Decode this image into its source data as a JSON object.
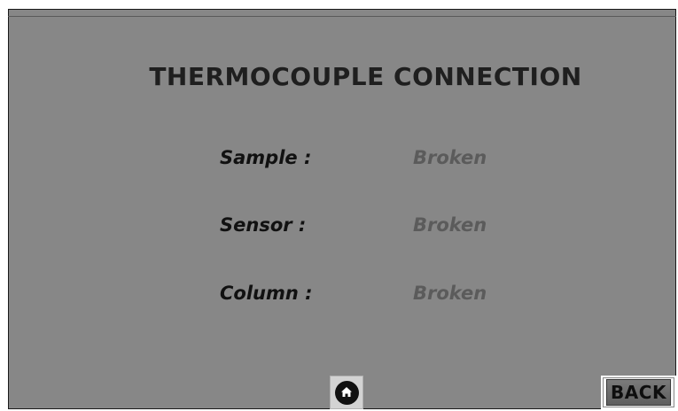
{
  "screen": {
    "title": "THERMOCOUPLE CONNECTION"
  },
  "rows": [
    {
      "label": "Sample :",
      "value": "Broken"
    },
    {
      "label": "Sensor :",
      "value": "Broken"
    },
    {
      "label": "Column :",
      "value": "Broken"
    }
  ],
  "footer": {
    "home_icon": "home-icon",
    "back_label": "BACK"
  },
  "colors": {
    "panel_background": "#878787",
    "label_text": "#111111",
    "value_text": "#5b5b5b"
  }
}
